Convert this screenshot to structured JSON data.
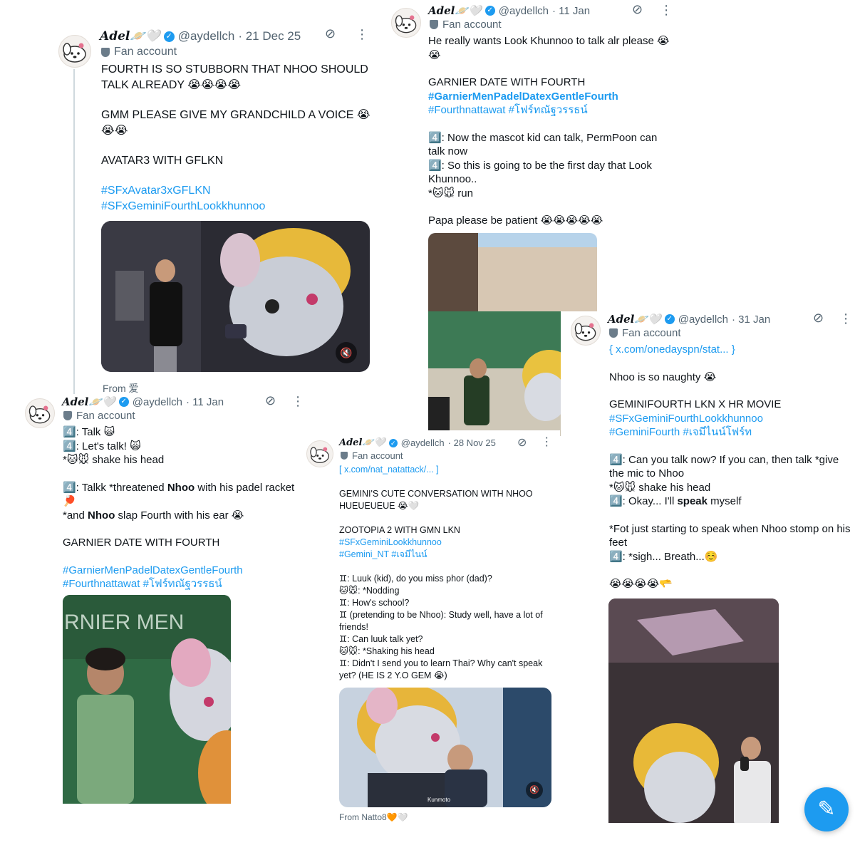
{
  "accent_color": "#1d9bf0",
  "profile": {
    "display_name": "Adel🪐🤍",
    "handle": "@aydellch",
    "badge": "Fan account",
    "avatar_icon": "cartoon-dog-avatar",
    "verified_icon": "verified-badge-icon",
    "header_icons": [
      "grok-icon",
      "more-icon"
    ]
  },
  "posts": [
    {
      "date": "· 21 Dec 25",
      "paragraphs": [
        "FOURTH IS SO STUBBORN THAT NHOO SHOULD TALK ALREADY 😭😭😭😭",
        "GMM PLEASE GIVE MY GRANDCHILD A VOICE 😭😭😭",
        "AVATAR3 WITH GFLKN"
      ],
      "hashtags": [
        "#SFxAvatar3xGFLKN",
        "#SFxGeminiFourthLookkhunnoo"
      ],
      "media_alt": "man in black t-shirt with mouse mascot holding phone",
      "media_icon": "volume-off-icon",
      "footer": "From 爱"
    },
    {
      "date": "· 11 Jan",
      "paragraphs": [
        "He really wants Look Khunnoo to talk alr please 😭😭",
        "GARNIER DATE WITH FOURTH"
      ],
      "hashtags": [
        "#GarnierMenPadelDatexGentleFourth",
        "#Fourthnattawat #โฟร์ทณัฐวรรธน์"
      ],
      "paragraphs_after": [
        "4️⃣: Now the mascot kid can talk, PermPoon can talk now\n4️⃣: So this is going to be the first day that Look Khunnoo..\n*🐱🐭 run",
        "Papa please be patient 😭😭😭😭😭"
      ],
      "media_alt": "padel court with man in green jacket and mascot"
    },
    {
      "date": "· 31 Jan",
      "link": "{ x.com/onedayspn/stat... }",
      "paragraphs": [
        "Nhoo is so naughty 😭",
        "GEMINIFOURTH LKN X HR MOVIE"
      ],
      "hashtags": [
        "#SFxGeminiFourthLookkhunnoo",
        "#GeminiFourth #เจมีไนน์โฟร์ท"
      ],
      "dialogue": [
        "4️⃣: Can you talk now? If you can, then talk *give the mic to Nhoo",
        "*🐱🐭 shake his head",
        "4️⃣: Okay... I'll ",
        "speak",
        " myself",
        "*Fot just starting to speak when Nhoo stomp on his feet",
        "4️⃣: *sigh... Breath...☺️",
        "😭😭😭😭🫳"
      ],
      "media_alt": "man with microphone next to mascot on stage"
    },
    {
      "date": "· 11 Jan",
      "lines": [
        "4️⃣: Talk 🙀",
        "4️⃣: Let's talk! 🙀",
        "*🐱🐭 shake his head"
      ],
      "line_talkk": [
        "4️⃣: Talkk *threatened ",
        "Nhoo",
        " with his padel racket 🏓"
      ],
      "line_slap": [
        "*and ",
        "Nhoo",
        " slap Fourth with his ear 😭"
      ],
      "paragraphs": [
        "GARNIER DATE WITH FOURTH"
      ],
      "hashtags": [
        "#GarnierMenPadelDatexGentleFourth",
        "#Fourthnattawat #โฟร์ทณัฐวรรธน์"
      ],
      "banner_text": "RNIER MEN",
      "media_alt": "man in green shirt next to mouse mascot with Garnier Men banner"
    },
    {
      "date": "· 28 Nov 25",
      "link": "[ x.com/nat_natattack/... ]",
      "paragraphs": [
        "GEMINI'S CUTE CONVERSATION WITH NHOO HUEUEUEUE 😭🤍",
        "ZOOTOPIA 2 WITH GMN LKN"
      ],
      "hashtags": [
        "#SFxGeminiLookkhunnoo",
        "#Gemini_NT #เจมีไนน์"
      ],
      "dialogue": [
        "♊: Luuk (kid), do you miss phor (dad)?",
        "🐱🐭: *Nodding",
        "♊: How's school?",
        "♊ (pretending to be Nhoo): Study well, have a lot of friends!",
        "♊: Can luuk talk yet?",
        "🐱🐭: *Shaking his head",
        "♊: Didn't I send you to learn Thai? Why can't speak yet? (HE IS 2 Y.O GEM 😭)"
      ],
      "media_caption": "Kunmoto",
      "media_icon": "volume-off-icon",
      "footer": "From Natto8🧡🤍"
    }
  ],
  "compose_button": {
    "icon": "compose-feather-icon",
    "symbol": "✎"
  }
}
